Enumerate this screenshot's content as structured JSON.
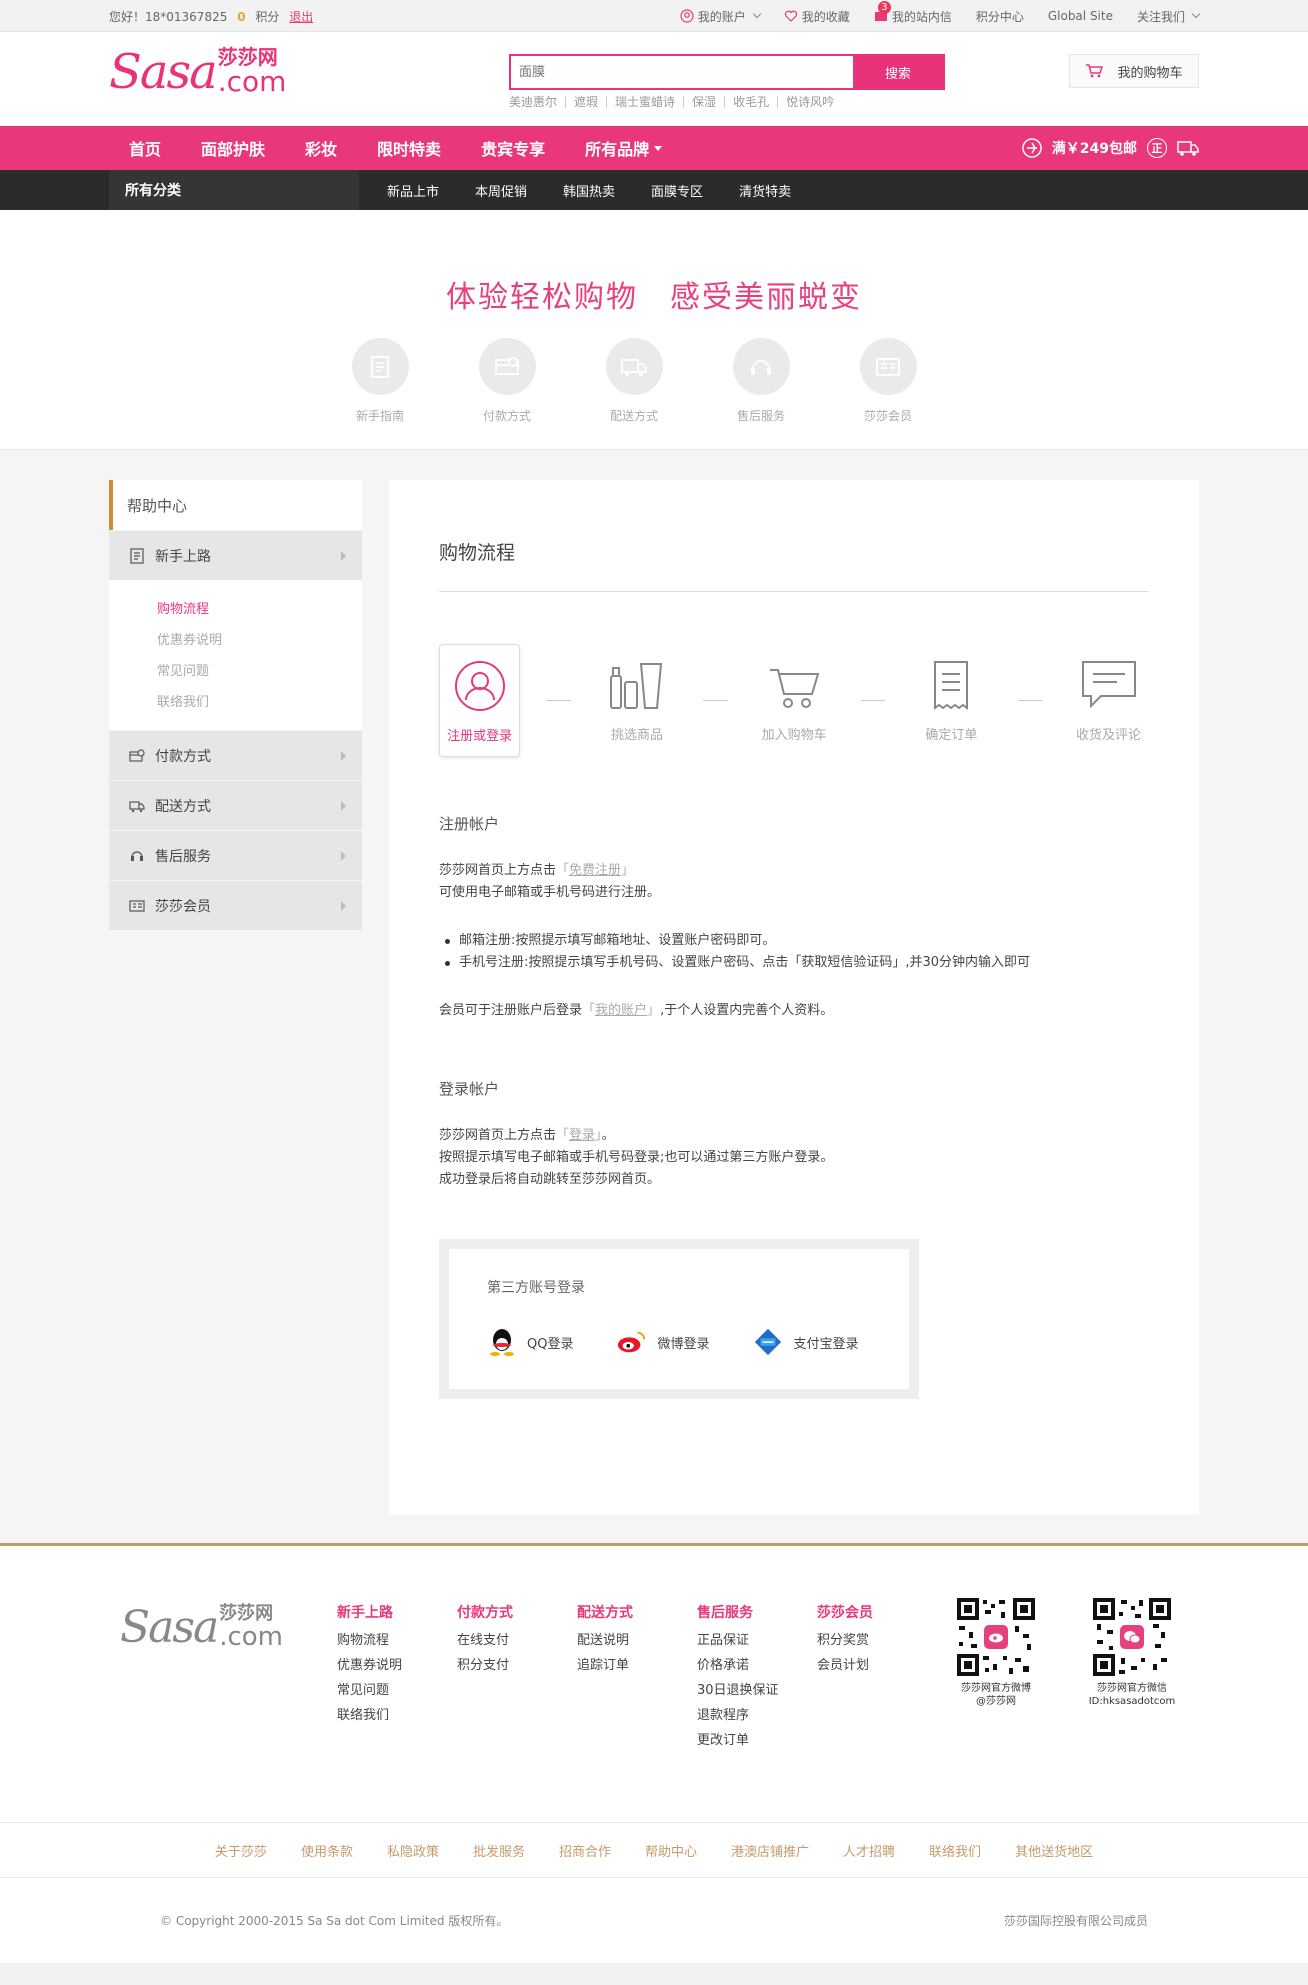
{
  "topbar": {
    "greeting": "您好！18*01367825",
    "points": "0",
    "points_label": "积分",
    "logout": "退出",
    "account": "我的账户",
    "favorites": "我的收藏",
    "messages_count": "3",
    "messages": "我的站内信",
    "points_center": "积分中心",
    "global": "Global Site",
    "follow": "关注我们"
  },
  "header": {
    "logo_text": "Sasa",
    "logo_cn": "莎莎网",
    "logo_com": ".com",
    "search_placeholder": "面膜",
    "search_button": "搜索",
    "hot_keywords": [
      "美迪惠尔",
      "遮瑕",
      "瑞士蜜蜡诗",
      "保湿",
      "收毛孔",
      "悦诗风吟"
    ],
    "cart": "我的购物车"
  },
  "nav": {
    "items": [
      "首页",
      "面部护肤",
      "彩妆",
      "限时特卖",
      "贵宾专享",
      "所有品牌"
    ],
    "free_shipping": "满￥249包邮",
    "genuine": "正"
  },
  "subnav": {
    "all_categories": "所有分类",
    "links": [
      "新品上市",
      "本周促销",
      "韩国热卖",
      "面膜专区",
      "清货特卖"
    ]
  },
  "banner": {
    "title": "体验轻松购物　感受美丽蜕变",
    "guides": [
      "新手指南",
      "付款方式",
      "配送方式",
      "售后服务",
      "莎莎会员"
    ]
  },
  "sidebar": {
    "title": "帮助中心",
    "cats": [
      "新手上路",
      "付款方式",
      "配送方式",
      "售后服务",
      "莎莎会员"
    ],
    "sub_items": [
      "购物流程",
      "优惠券说明",
      "常见问题",
      "联络我们"
    ]
  },
  "main": {
    "title": "购物流程",
    "steps": [
      "注册或登录",
      "挑选商品",
      "加入购物车",
      "确定订单",
      "收货及评论"
    ],
    "register_title": "注册帐户",
    "register_p1a": "莎莎网首页上方点击",
    "register_link": "免费注册",
    "register_p2": "可使用电子邮箱或手机号码进行注册。",
    "bullet1": "邮箱注册:按照提示填写邮箱地址、设置账户密码即可。",
    "bullet2": "手机号注册:按照提示填写手机号码、设置账户密码、点击「获取短信验证码」,并30分钟内输入即可",
    "member_p_a": "会员可于注册账户后登录",
    "member_link": "我的账户",
    "member_p_b": ",于个人设置内完善个人资料。",
    "login_title": "登录帐户",
    "login_p1a": "莎莎网首页上方点击",
    "login_link": "登录",
    "login_p1b": "。",
    "login_p2": "按照提示填写电子邮箱或手机号码登录;也可以通过第三方账户登录。",
    "login_p3": "成功登录后将自动跳转至莎莎网首页。",
    "third_title": "第三方账号登录",
    "third_qq": "QQ登录",
    "third_weibo": "微博登录",
    "third_alipay": "支付宝登录"
  },
  "footer": {
    "logo_text": "Sasa",
    "logo_cn": "莎莎网",
    "logo_com": ".com",
    "cols": [
      {
        "title": "新手上路",
        "links": [
          "购物流程",
          "优惠券说明",
          "常见问题",
          "联络我们"
        ]
      },
      {
        "title": "付款方式",
        "links": [
          "在线支付",
          "积分支付"
        ]
      },
      {
        "title": "配送方式",
        "links": [
          "配送说明",
          "追踪订单"
        ]
      },
      {
        "title": "售后服务",
        "links": [
          "正品保证",
          "价格承诺",
          "30日退换保证",
          "退款程序",
          "更改订单"
        ]
      },
      {
        "title": "莎莎会员",
        "links": [
          "积分奖赏",
          "会员计划"
        ]
      }
    ],
    "qr_weibo_line1": "莎莎网官方微博",
    "qr_weibo_line2": "@莎莎网",
    "qr_wechat_line1": "莎莎网官方微信",
    "qr_wechat_line2": "ID:hksasadotcom",
    "links": [
      "关于莎莎",
      "使用条款",
      "私隐政策",
      "批发服务",
      "招商合作",
      "帮助中心",
      "港澳店铺推广",
      "人才招聘",
      "联络我们",
      "其他送货地区"
    ],
    "copyright": "© Copyright 2000-2015 Sa Sa dot Com Limited 版权所有。",
    "member": "莎莎国际控股有限公司成员"
  }
}
